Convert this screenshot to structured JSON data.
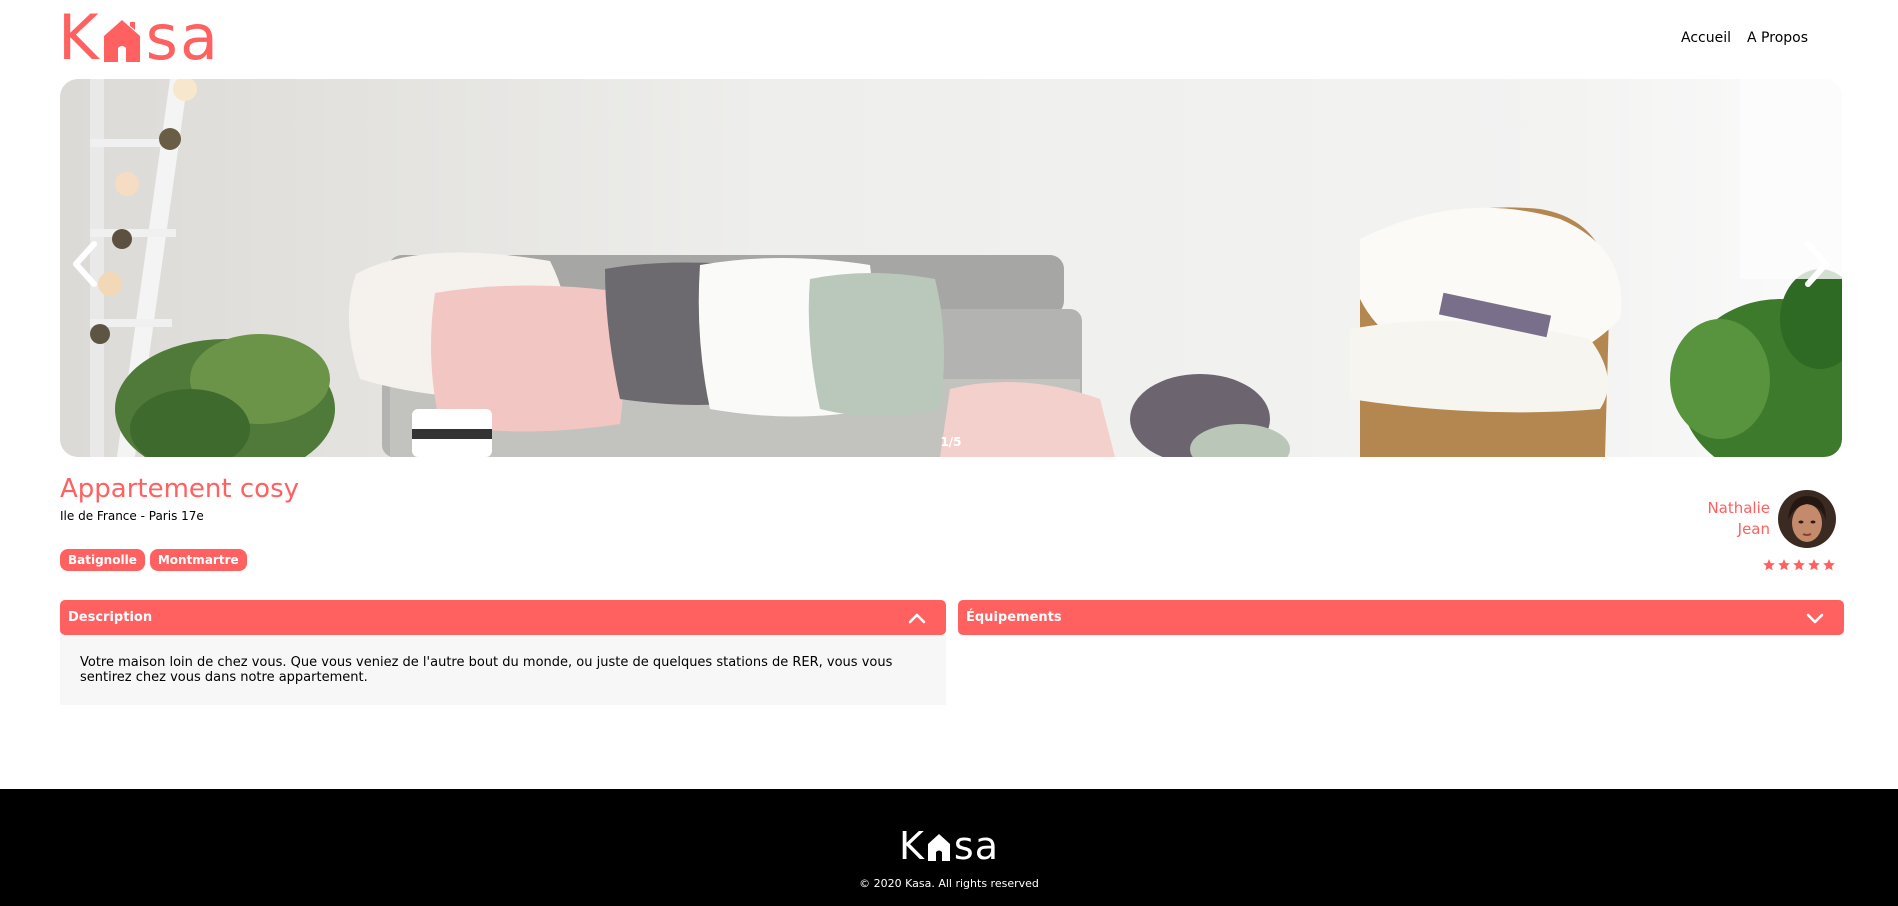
{
  "brand": {
    "logo_text_left": "K",
    "logo_text_right": "sa",
    "logo_alt": "Kasa",
    "color": "#FF6060"
  },
  "nav": {
    "items": [
      {
        "label": "Accueil"
      },
      {
        "label": "A Propos"
      }
    ]
  },
  "gallery": {
    "counter": "1/5",
    "prev_icon": "chevron-left-icon",
    "next_icon": "chevron-right-icon"
  },
  "listing": {
    "title": "Appartement cosy",
    "location": "Ile de France - Paris 17e",
    "tags": [
      "Batignolle",
      "Montmartre"
    ]
  },
  "host": {
    "first_name": "Nathalie",
    "last_name": "Jean",
    "rating": 5,
    "rating_max": 5
  },
  "collapses": {
    "description": {
      "title": "Description",
      "open": true,
      "text": "Votre maison loin de chez vous. Que vous veniez de l'autre bout du monde, ou juste de quelques stations de RER, vous vous sentirez chez vous dans notre appartement."
    },
    "equipements": {
      "title": "Équipements",
      "open": false
    }
  },
  "footer": {
    "copyright": "© 2020 Kasa. All rights reserved"
  }
}
